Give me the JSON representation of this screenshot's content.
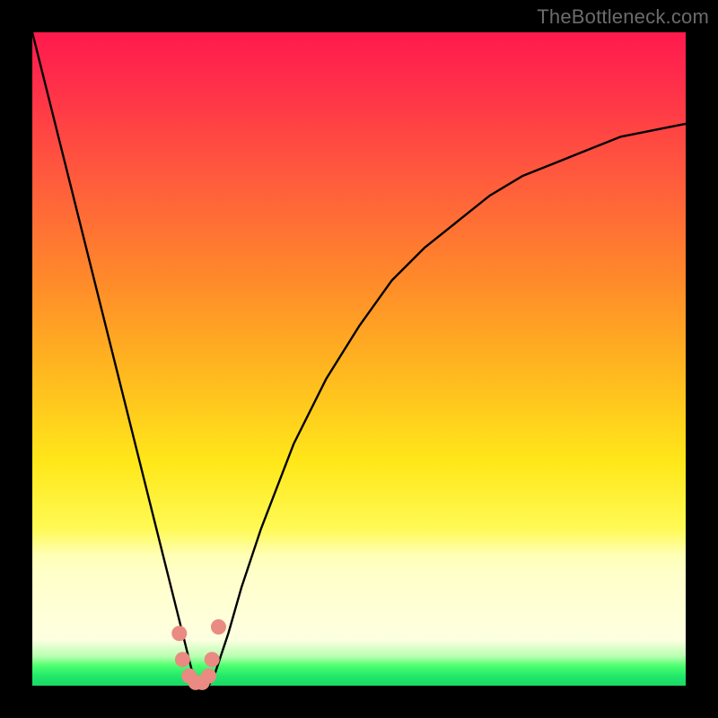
{
  "watermark": {
    "text": "TheBottleneck.com"
  },
  "colors": {
    "curve_stroke": "#000000",
    "marker_fill": "#e98b82",
    "marker_stroke": "#e98b82"
  },
  "chart_data": {
    "type": "line",
    "title": "",
    "xlabel": "",
    "ylabel": "",
    "xlim": [
      0,
      100
    ],
    "ylim": [
      0,
      100
    ],
    "grid": false,
    "legend": false,
    "annotations": [],
    "series": [
      {
        "name": "bottleneck-curve",
        "x": [
          0,
          2,
          4,
          6,
          8,
          10,
          12,
          14,
          16,
          18,
          20,
          22,
          23,
          24,
          25,
          26,
          27,
          28,
          30,
          32,
          35,
          40,
          45,
          50,
          55,
          60,
          65,
          70,
          75,
          80,
          85,
          90,
          95,
          100
        ],
        "y": [
          100,
          92,
          84,
          76,
          68,
          60,
          52,
          44,
          36,
          28,
          20,
          12,
          8,
          4,
          0,
          0,
          0,
          2,
          8,
          15,
          24,
          37,
          47,
          55,
          62,
          67,
          71,
          75,
          78,
          80,
          82,
          84,
          85,
          86
        ]
      }
    ],
    "markers": {
      "name": "valley-markers",
      "x": [
        22.5,
        23.0,
        24.0,
        25.0,
        26.0,
        27.0,
        27.5,
        28.5
      ],
      "y": [
        8.0,
        4.0,
        1.5,
        0.5,
        0.5,
        1.5,
        4.0,
        9.0
      ]
    }
  }
}
